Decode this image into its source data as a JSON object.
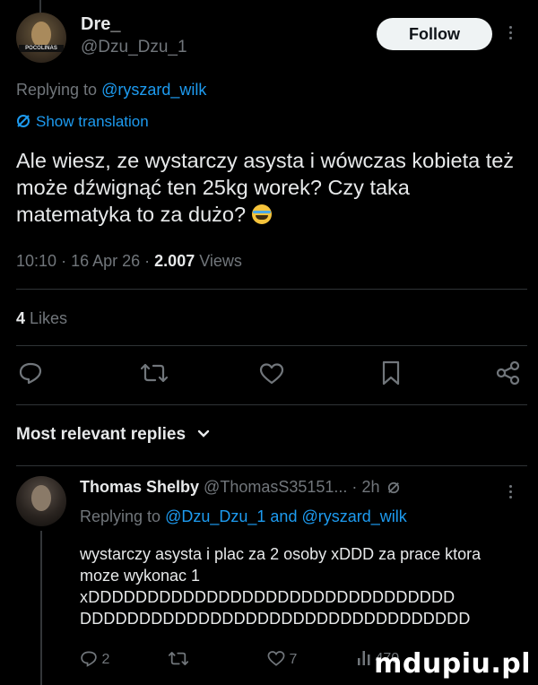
{
  "author": {
    "name": "Dre_",
    "handle": "@Dzu_Dzu_1",
    "avatar_badge": "POCOLINAS"
  },
  "follow_label": "Follow",
  "replying": {
    "prefix": "Replying to",
    "mention": "@ryszard_wilk"
  },
  "translation_label": "Show translation",
  "tweet_text": "Ale wiesz, ze wystarczy asysta i wówczas kobieta też może dźwignąć ten 25kg worek? Czy taka matematyka to za dużo?",
  "meta": {
    "time": "10:10",
    "dot1": "·",
    "date": "16 Apr 26",
    "dot2": "·",
    "views_count": "2.007",
    "views_label": "Views"
  },
  "likes": {
    "count": "4",
    "label": "Likes"
  },
  "replies_header": {
    "label": "Most relevant replies"
  },
  "reply": {
    "name": "Thomas Shelby",
    "handle": "@ThomasS35151...",
    "dot": "·",
    "time": "2h",
    "replying_prefix": "Replying to",
    "mention1": "@Dzu_Dzu_1",
    "and": "and",
    "mention2": "@ryszard_wilk",
    "text": "wystarczy asysta i plac za 2 osoby xDDD za prace ktora moze wykonac 1",
    "text2": "xDDDDDDDDDDDDDDDDDDDDDDDDDDDDDDD",
    "text3": "DDDDDDDDDDDDDDDDDDDDDDDDDDDDDDDDD",
    "reply_count": "2",
    "like_count": "7",
    "view_count": "470"
  },
  "watermark": "mdupiu.pl",
  "colors": {
    "background": "#000000",
    "text": "#e7e9ea",
    "muted": "#71767b",
    "link": "#1d9bf0",
    "follow_bg": "#eff3f4"
  }
}
